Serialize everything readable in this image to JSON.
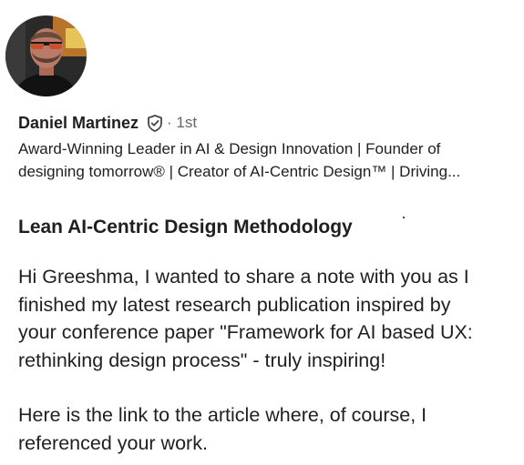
{
  "sender": {
    "name": "Daniel Martinez",
    "degree": "· 1st",
    "headline_lines": [
      "Award-Winning Leader in AI & Design Innovation | Founder of",
      "designing tomorrow® | Creator of AI-Centric Design™ | Driving..."
    ],
    "avatar_icon": "profile-photo",
    "verified_icon": "verified-shield-icon"
  },
  "message": {
    "subject": "Lean AI-Centric Design Methodology",
    "paragraph1_lines": [
      "Hi Greeshma, I wanted to share a note with you as I",
      "finished my latest research publication inspired by",
      "your conference paper \"Framework for AI based UX:",
      "rethinking design process\" - truly inspiring!"
    ],
    "paragraph2_lines": [
      "Here is the link to the article where, of course, I",
      "referenced your work."
    ]
  }
}
